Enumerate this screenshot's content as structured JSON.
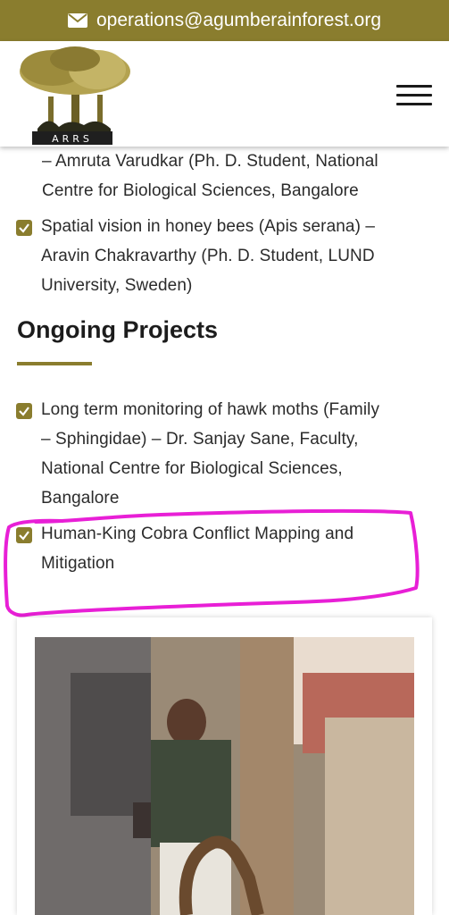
{
  "topbar": {
    "email": "operations@agumberainforest.org",
    "icon": "envelope-icon"
  },
  "header": {
    "logo_text": "ARRS",
    "menu_icon": "hamburger-menu-icon"
  },
  "completed_items": [
    {
      "lines": [
        "– Amruta Varudkar (Ph. D. Student, National",
        "Centre for Biological Sciences, Bangalore"
      ]
    },
    {
      "lines": [
        "Spatial vision in honey bees (Apis serana) –",
        "Aravin Chakravarthy (Ph. D. Student, LUND",
        "University, Sweden)"
      ]
    }
  ],
  "ongoing": {
    "heading": "Ongoing Projects",
    "items": [
      {
        "lines": [
          "Long term monitoring of hawk moths (Family",
          "– Sphingidae) – Dr. Sanjay Sane, Faculty,",
          "National Centre for Biological Sciences,",
          "Bangalore"
        ]
      },
      {
        "lines": [
          "Human-King Cobra Conflict Mapping and",
          "Mitigation"
        ]
      }
    ]
  },
  "colors": {
    "accent": "#8a7d2e",
    "highlight": "#e81fd6"
  }
}
